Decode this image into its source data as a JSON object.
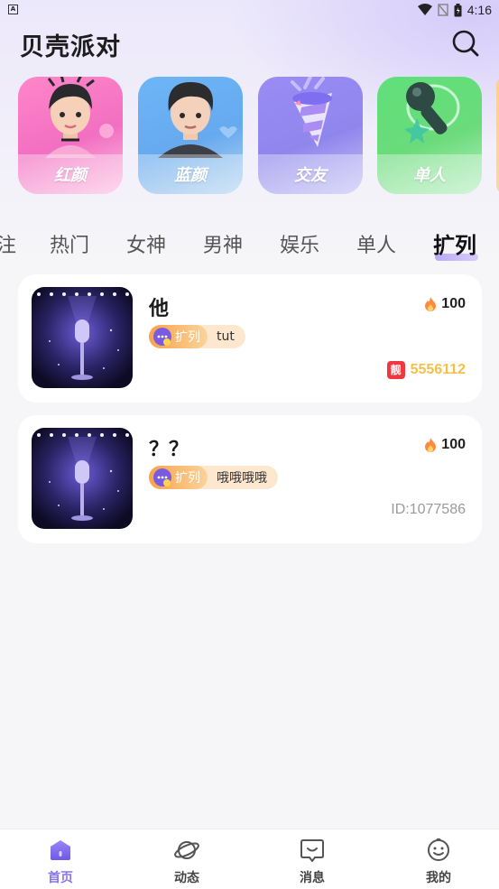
{
  "status_bar": {
    "time": "4:16",
    "app_icon": "A"
  },
  "header": {
    "title": "贝壳派对"
  },
  "categories": [
    {
      "label": "红颜",
      "icon": "girl-avatar"
    },
    {
      "label": "蓝颜",
      "icon": "boy-avatar"
    },
    {
      "label": "交友",
      "icon": "party-popper"
    },
    {
      "label": "单人",
      "icon": "microphone"
    }
  ],
  "tabs": [
    "注",
    "热门",
    "女神",
    "男神",
    "娱乐",
    "单人",
    "扩列"
  ],
  "active_tab": "扩列",
  "rooms": [
    {
      "name": "他",
      "heat": "100",
      "tag": "扩列",
      "desc": "tut",
      "pretty_badge": "靓",
      "id_text": "5556112"
    },
    {
      "name": "？？",
      "heat": "100",
      "tag": "扩列",
      "desc": "哦哦哦哦",
      "id_text": "ID:1077586"
    }
  ],
  "nav": [
    {
      "label": "首页",
      "icon": "home-icon",
      "active": true
    },
    {
      "label": "动态",
      "icon": "planet-icon",
      "active": false
    },
    {
      "label": "消息",
      "icon": "message-icon",
      "active": false
    },
    {
      "label": "我的",
      "icon": "profile-icon",
      "active": false
    }
  ],
  "colors": {
    "accent": "#8a73ee",
    "pretty_id": "#f4c04a",
    "tag_orange": "#f7a34b"
  }
}
